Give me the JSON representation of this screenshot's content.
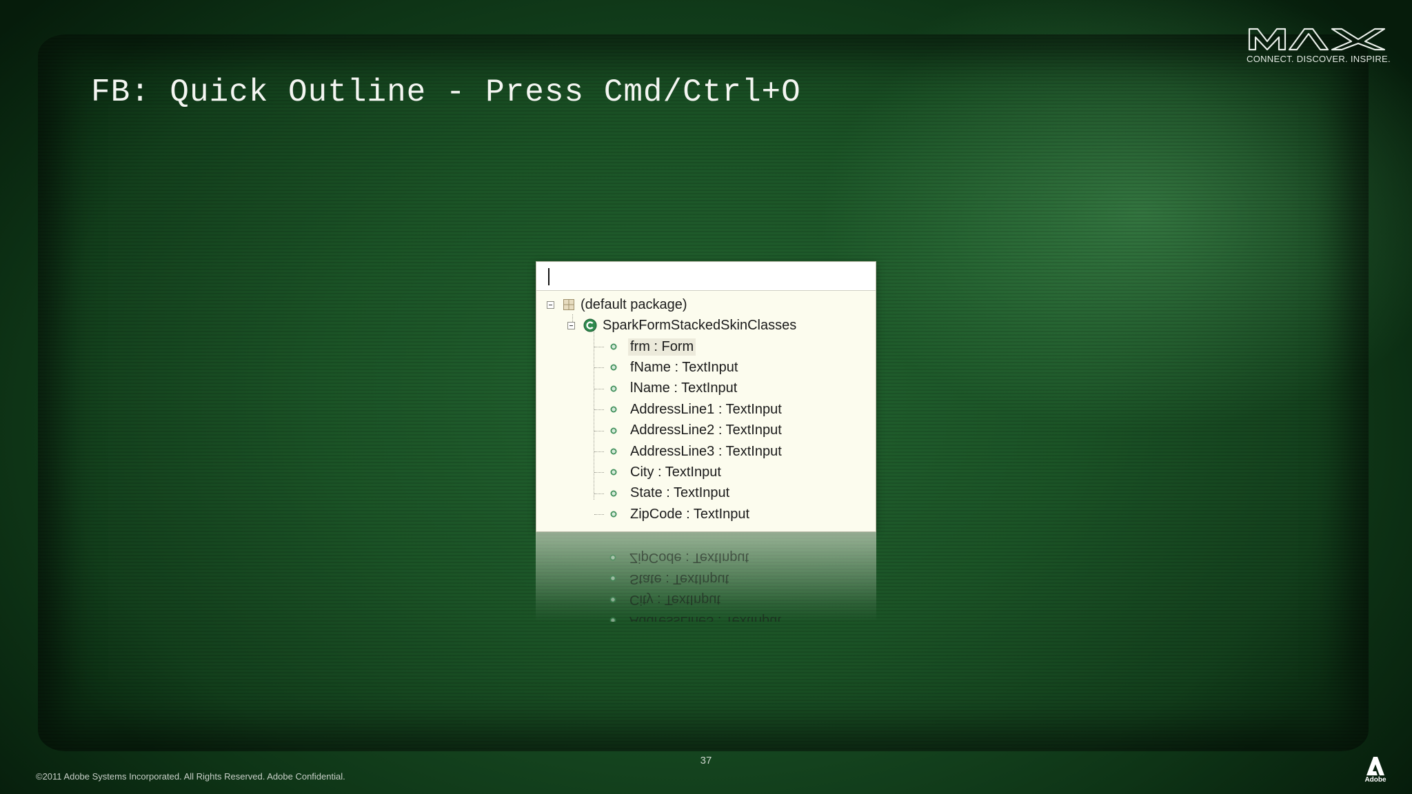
{
  "slide": {
    "title": "FB: Quick Outline - Press Cmd/Ctrl+O",
    "page_number": "37",
    "copyright": "©2011 Adobe Systems Incorporated.  All Rights Reserved. Adobe Confidential."
  },
  "branding": {
    "max_logo_text": "MAX",
    "tagline": "CONNECT. DISCOVER. INSPIRE.",
    "adobe_label": "Adobe"
  },
  "outline": {
    "filter": {
      "value": "",
      "placeholder": ""
    },
    "package": {
      "label": "(default package)",
      "icon": "package-icon",
      "expanded": true
    },
    "class": {
      "label": "SparkFormStackedSkinClasses",
      "icon": "class-icon",
      "expanded": true
    },
    "fields": [
      {
        "label": "frm : Form",
        "selected": true
      },
      {
        "label": "fName : TextInput",
        "selected": false
      },
      {
        "label": "lName : TextInput",
        "selected": false
      },
      {
        "label": "AddressLine1 : TextInput",
        "selected": false
      },
      {
        "label": "AddressLine2 : TextInput",
        "selected": false
      },
      {
        "label": "AddressLine3 : TextInput",
        "selected": false
      },
      {
        "label": "City : TextInput",
        "selected": false
      },
      {
        "label": "State : TextInput",
        "selected": false
      },
      {
        "label": "ZipCode : TextInput",
        "selected": false
      }
    ]
  },
  "colors": {
    "background_green": "#1b5326",
    "popup_bg": "#fcfcee",
    "field_icon": "#3f8f5a",
    "class_icon": "#2f8a4e"
  }
}
